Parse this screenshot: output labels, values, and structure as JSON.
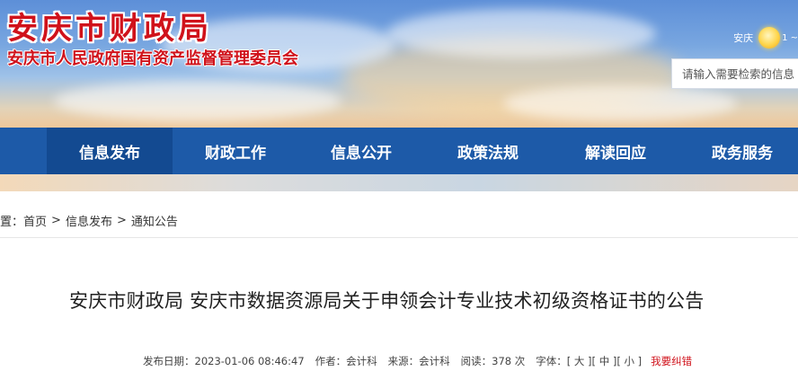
{
  "header": {
    "site_title": "安庆市财政局",
    "site_subtitle": "安庆市人民政府国有资产监督管理委员会",
    "weather": {
      "city": "安庆",
      "icon": "sun-icon",
      "temp": "1 ~"
    },
    "search": {
      "placeholder": "请输入需要检索的信息"
    }
  },
  "nav": {
    "items": [
      {
        "label": "信息发布",
        "active": true
      },
      {
        "label": "财政工作",
        "active": false
      },
      {
        "label": "信息公开",
        "active": false
      },
      {
        "label": "政策法规",
        "active": false
      },
      {
        "label": "解读回应",
        "active": false
      },
      {
        "label": "政务服务",
        "active": false
      }
    ]
  },
  "breadcrumb": {
    "prefix": "置：",
    "items": [
      "首页",
      "信息发布",
      "通知公告"
    ],
    "separator": ">"
  },
  "article": {
    "title": "安庆市财政局 安庆市数据资源局关于申领会计专业技术初级资格证书的公告",
    "meta": {
      "date": "发布日期：2023-01-06 08:46:47",
      "author": "作者：会计科",
      "source": "来源：会计科",
      "views": "阅读：378 次",
      "font_label": "字体：",
      "font_large": "[ 大 ]",
      "font_medium": "[ 中 ]",
      "font_small": "[ 小 ]",
      "error_link": "我要纠错"
    }
  },
  "colors": {
    "title_red": "#d0121b",
    "nav_blue": "#1d5aa8",
    "nav_active": "#134a91"
  }
}
